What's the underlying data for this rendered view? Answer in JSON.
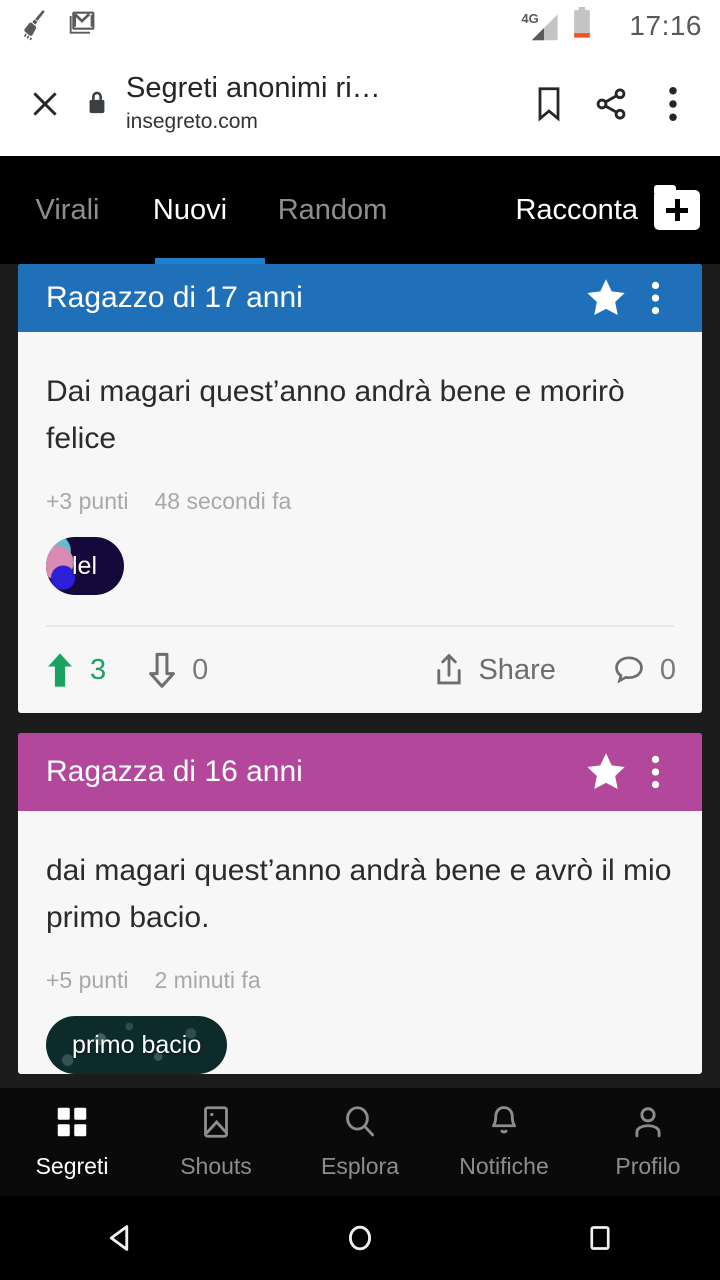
{
  "status_bar": {
    "icons": [
      "broom-icon",
      "gmail-icon"
    ],
    "network": "4G",
    "battery": "low",
    "time": "17:16"
  },
  "browser_header": {
    "close_icon": "close-icon",
    "lock_icon": "lock-icon",
    "title": "Segreti anonimi ri…",
    "url": "insegreto.com",
    "bookmark_icon": "bookmark-icon",
    "share_icon": "share-icon",
    "overflow_icon": "overflow-menu-icon"
  },
  "tabbar": {
    "tabs": [
      {
        "label": "Virali",
        "active": false
      },
      {
        "label": "Nuovi",
        "active": true
      },
      {
        "label": "Random",
        "active": false
      }
    ],
    "compose_label": "Racconta",
    "compose_icon": "add-folder-icon",
    "active_underline_color": "#2080d0"
  },
  "feed": {
    "cards": [
      {
        "header_color": "#1f70b8",
        "title": "Ragazzo di 17 anni",
        "star_icon": "star-icon",
        "overflow_icon": "overflow-menu-icon",
        "text": "Dai magari quest’anno andrà bene e morirò felice",
        "points": "+3 punti",
        "time": "48 secondi fa",
        "tag": "lel",
        "upvotes": "3",
        "downvotes": "0",
        "share_label": "Share",
        "comments": "0"
      },
      {
        "header_color": "#b2479b",
        "title": "Ragazza di 16 anni",
        "star_icon": "star-icon",
        "overflow_icon": "overflow-menu-icon",
        "text": "dai magari quest’anno andrà bene e avrò il mio primo bacio.",
        "points": "+5 punti",
        "time": "2 minuti fa",
        "tag": "primo bacio"
      }
    ]
  },
  "bottom_nav": {
    "items": [
      {
        "label": "Segreti",
        "icon": "grid-icon",
        "active": true
      },
      {
        "label": "Shouts",
        "icon": "image-icon",
        "active": false
      },
      {
        "label": "Esplora",
        "icon": "search-icon",
        "active": false
      },
      {
        "label": "Notifiche",
        "icon": "bell-icon",
        "active": false
      },
      {
        "label": "Profilo",
        "icon": "person-icon",
        "active": false
      }
    ]
  },
  "android_nav": {
    "back_icon": "back-triangle-icon",
    "home_icon": "home-circle-icon",
    "recents_icon": "recents-square-icon"
  },
  "colors": {
    "accent_blue": "#2080d0",
    "card_blue": "#1f70b8",
    "card_magenta": "#b2479b",
    "upvote_green": "#1aa260",
    "page_bg": "#1c1c1c"
  }
}
